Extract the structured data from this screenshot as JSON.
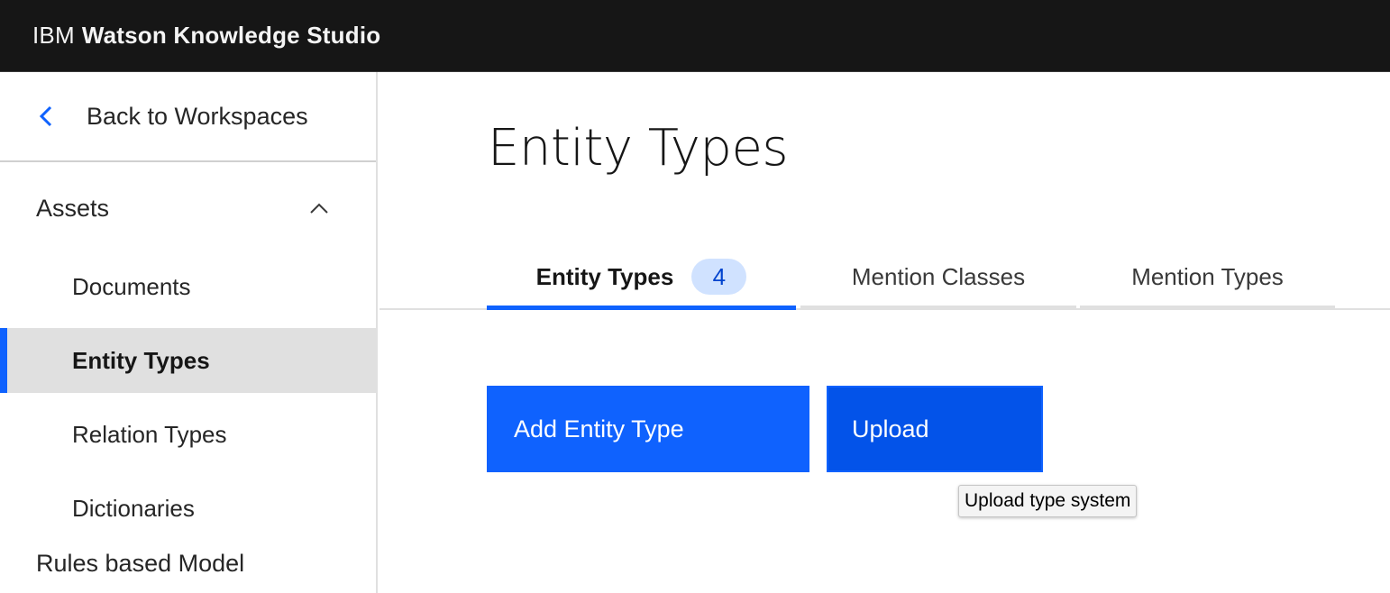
{
  "header": {
    "brand_prefix": "IBM",
    "product_name": "Watson Knowledge Studio"
  },
  "sidebar": {
    "back_label": "Back to Workspaces",
    "section_title": "Assets",
    "items": [
      {
        "label": "Documents",
        "active": false
      },
      {
        "label": "Entity Types",
        "active": true
      },
      {
        "label": "Relation Types",
        "active": false
      },
      {
        "label": "Dictionaries",
        "active": false
      }
    ],
    "next_group_label": "Rules based Model"
  },
  "main": {
    "title": "Entity Types",
    "tabs": [
      {
        "label": "Entity Types",
        "count": "4",
        "selected": true
      },
      {
        "label": "Mention Classes",
        "selected": false
      },
      {
        "label": "Mention Types",
        "selected": false
      }
    ],
    "add_button_label": "Add Entity Type",
    "upload_button_label": "Upload",
    "tooltip": "Upload type system"
  },
  "colors": {
    "accent": "#0f62fe",
    "header_bg": "#161616",
    "badge_bg": "#d0e2ff"
  }
}
